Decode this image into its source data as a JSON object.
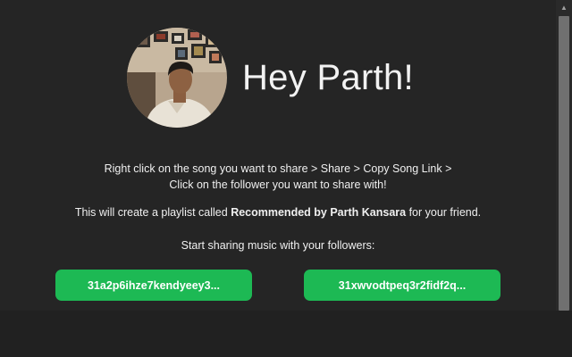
{
  "greeting": "Hey Parth!",
  "avatar_alt": "profile photo",
  "instructions": {
    "line1": "Right click on the song you want to share > Share > Copy Song Link >",
    "line2": "Click on the follower you want to share with!",
    "playlist_prefix": "This will create a playlist called ",
    "playlist_name": "Recommended by Parth Kansara",
    "playlist_suffix": " for your friend.",
    "start_sharing": "Start sharing music with your followers:"
  },
  "followers": [
    {
      "label": "31a2p6ihze7kendyeey3..."
    },
    {
      "label": "31xwvodtpeq3r2fidf2q..."
    }
  ],
  "colors": {
    "background": "#252525",
    "accent": "#1db954",
    "text": "#ffffff"
  },
  "icons": {
    "scroll_up": "chevron-up-icon"
  }
}
